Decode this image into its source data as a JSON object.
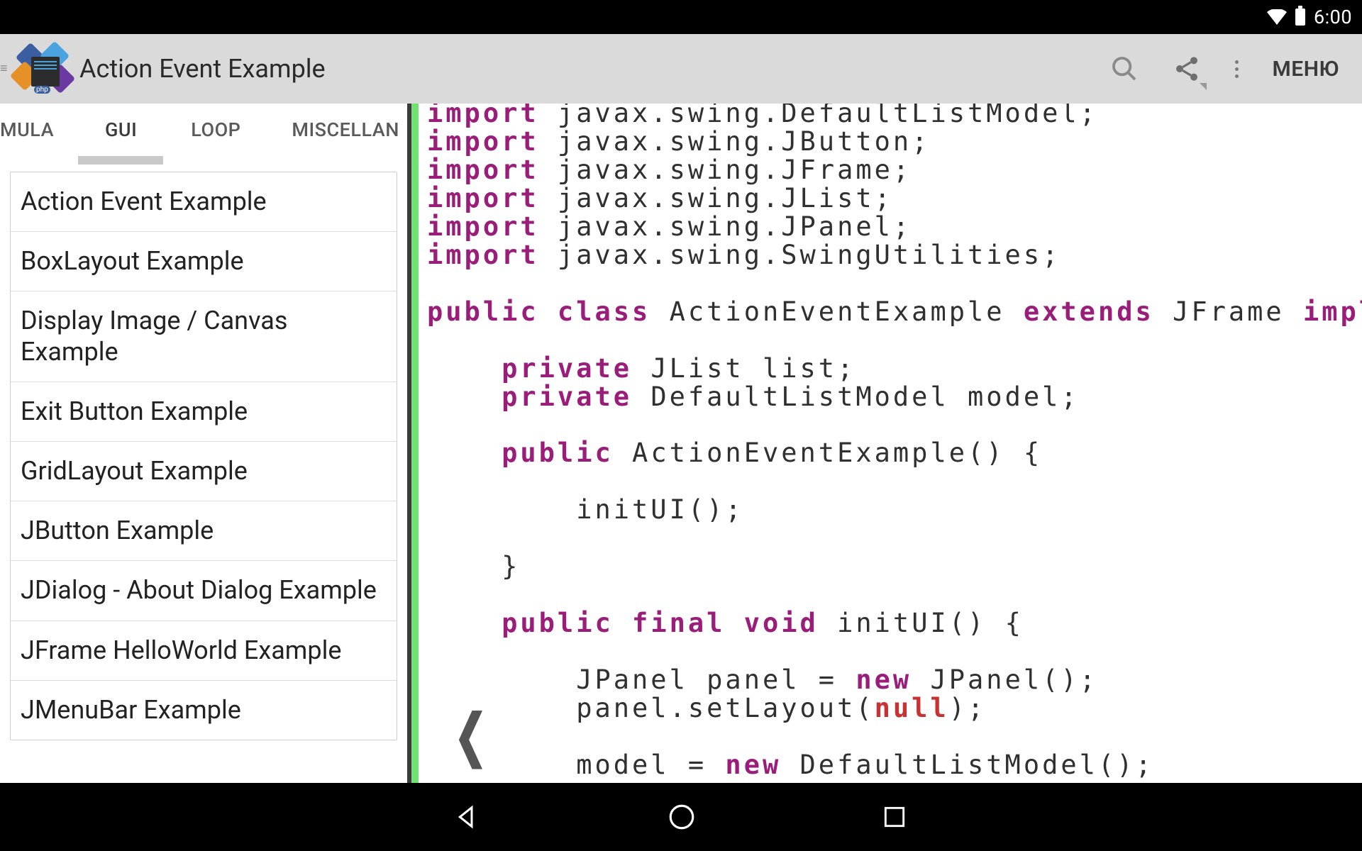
{
  "statusbar": {
    "time": "6:00"
  },
  "actionbar": {
    "title": "Action Event Example",
    "menu_label": "МЕНЮ"
  },
  "tabs": {
    "items": [
      "MULA",
      "GUI",
      "LOOP",
      "MISCELLAN"
    ],
    "active_index": 1
  },
  "sidebar_items": [
    "Action Event Example",
    "BoxLayout Example",
    "Display Image / Canvas Example",
    "Exit Button Example",
    "GridLayout Example",
    "JButton Example",
    "JDialog - About Dialog Example",
    "JFrame HelloWorld Example",
    "JMenuBar Example"
  ],
  "code": {
    "l0a": "import",
    "l0b": " javax.swing.DefaultListModel;",
    "l1a": "import",
    "l1b": " javax.swing.JButton;",
    "l2a": "import",
    "l2b": " javax.swing.JFrame;",
    "l3a": "import",
    "l3b": " javax.swing.JList;",
    "l4a": "import",
    "l4b": " javax.swing.JPanel;",
    "l5a": "import",
    "l5b": " javax.swing.SwingUtilities;",
    "l6a": "public class",
    "l6b": " ActionEventExample ",
    "l6c": "extends",
    "l6d": " JFrame ",
    "l6e": "implements",
    "l7a": "private",
    "l7b": " JList list;",
    "l8a": "private",
    "l8b": " DefaultListModel model;",
    "l9a": "public",
    "l9b": " ActionEventExample() {",
    "l10": "        initUI();",
    "l11": "    }",
    "l12a": "public final void",
    "l12b": " initUI() {",
    "l13a": "        JPanel panel = ",
    "l13b": "new",
    "l13c": " JPanel();",
    "l14a": "        panel.setLayout(",
    "l14b": "null",
    "l14c": ");",
    "l15a": "        model = ",
    "l15b": "new",
    "l15c": " DefaultListModel();"
  }
}
